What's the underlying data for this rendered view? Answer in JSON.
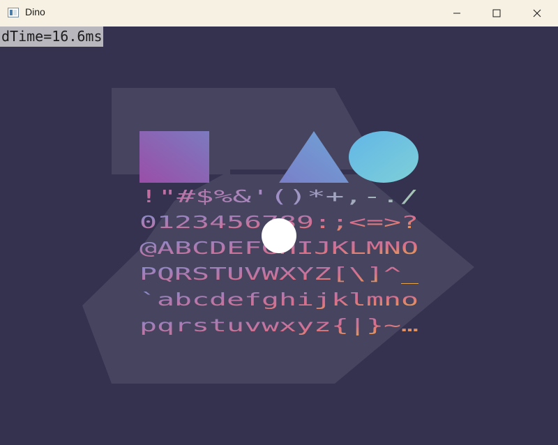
{
  "window": {
    "title": "Dino",
    "icon": "app-window-icon",
    "controls": [
      "minimize-icon",
      "maximize-icon",
      "close-icon"
    ]
  },
  "hud": {
    "frame_time": "dTime=16.6ms"
  },
  "scene": {
    "background_color": "#34324f",
    "shapes": [
      "square",
      "triangle",
      "ellipse",
      "circle"
    ],
    "glyph_rows": [
      " !\"#$%&'()*+,-./",
      "0123456789:;<=>?",
      "@ABCDEFGHIJKLMNO",
      "PQRSTUVWXYZ[\\]^_",
      "`abcdefghijklmno",
      "pqrstuvwxyz{|}~…"
    ],
    "colors": {
      "gradient_a": "#8a4fae",
      "gradient_b": "#74c6e4",
      "text_top": "#8eb4d2",
      "text_bottom": "#e8a842",
      "text_left": "#d2578f",
      "circle": "#ffffff",
      "logo": "#47445f"
    }
  }
}
